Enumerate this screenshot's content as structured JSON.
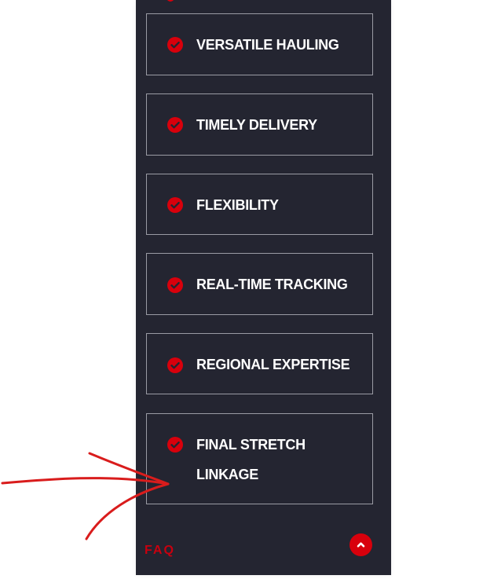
{
  "features": [
    {
      "label": "VERSATILE HAULING"
    },
    {
      "label": "TIMELY DELIVERY"
    },
    {
      "label": "FLEXIBILITY"
    },
    {
      "label": "REAL-TIME TRACKING"
    },
    {
      "label": "REGIONAL EXPERTISE"
    },
    {
      "label": "FINAL STRETCH LINKAGE"
    }
  ],
  "footer": {
    "faq_label": "FAQ"
  },
  "icons": {
    "feature": "check-circle-icon",
    "scroll_top": "chevron-up-icon"
  },
  "colors": {
    "panel_background": "#242531",
    "accent_red": "#d8000c",
    "box_border": "#9a9ba4",
    "label_text": "#ffffff"
  }
}
